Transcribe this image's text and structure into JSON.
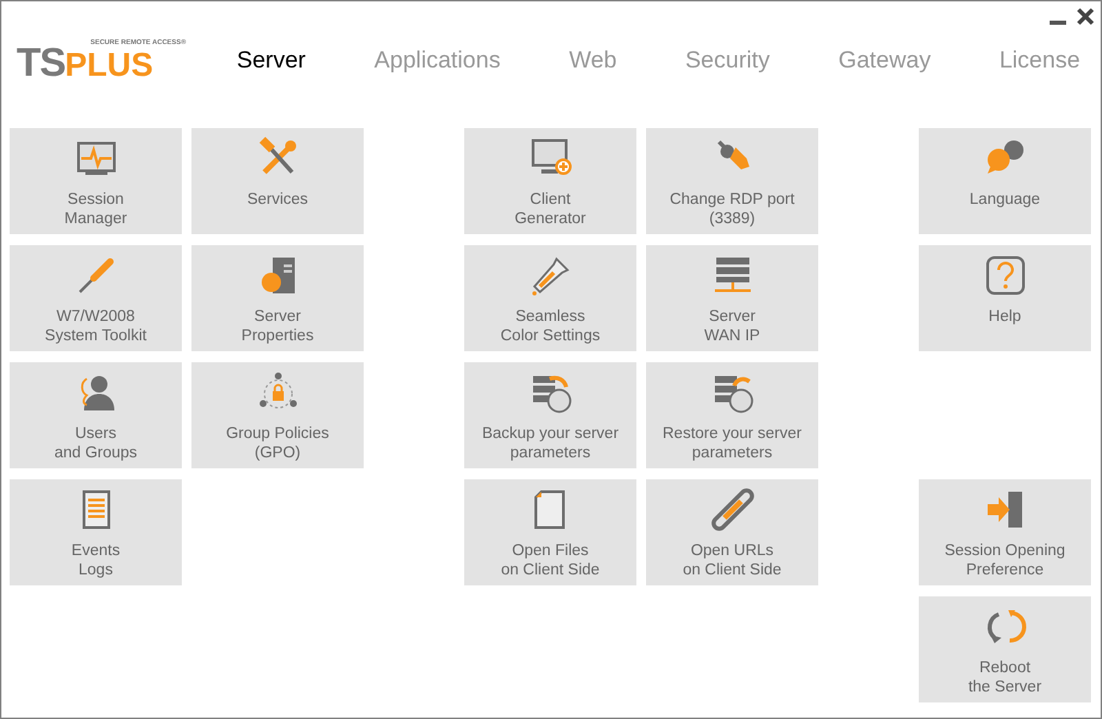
{
  "logo": {
    "main": "TS",
    "accent": "PLUS",
    "tagline": "SECURE REMOTE ACCESS®"
  },
  "tabs": [
    {
      "label": "Server",
      "selected": true
    },
    {
      "label": "Applications",
      "selected": false
    },
    {
      "label": "Web",
      "selected": false
    },
    {
      "label": "Security",
      "selected": false
    },
    {
      "label": "Gateway",
      "selected": false
    },
    {
      "label": "License",
      "selected": false
    }
  ],
  "groups": [
    {
      "columns": [
        [
          {
            "kind": "monitor-pulse",
            "lines": [
              "Session",
              "Manager"
            ]
          },
          {
            "kind": "screwdriver",
            "lines": [
              "W7/W2008",
              "System Toolkit"
            ]
          },
          {
            "kind": "user",
            "lines": [
              "Users",
              "and Groups"
            ]
          },
          {
            "kind": "scroll",
            "lines": [
              "Events",
              "Logs"
            ]
          }
        ],
        [
          {
            "kind": "tools",
            "lines": [
              "Services"
            ]
          },
          {
            "kind": "server-info",
            "lines": [
              "Server",
              "Properties"
            ]
          },
          {
            "kind": "group-lock",
            "lines": [
              "Group Policies",
              "(GPO)"
            ]
          }
        ]
      ]
    },
    {
      "columns": [
        [
          {
            "kind": "monitor-plus",
            "lines": [
              "Client",
              "Generator"
            ]
          },
          {
            "kind": "dropper",
            "lines": [
              "Seamless",
              "Color Settings"
            ]
          },
          {
            "kind": "backup",
            "lines": [
              "Backup your server",
              "parameters"
            ]
          },
          {
            "kind": "file",
            "lines": [
              "Open Files",
              "on Client Side"
            ]
          }
        ],
        [
          {
            "kind": "plug",
            "lines": [
              "Change RDP port",
              "(3389)"
            ]
          },
          {
            "kind": "server-network",
            "lines": [
              "Server",
              "WAN IP"
            ]
          },
          {
            "kind": "restore",
            "lines": [
              "Restore your server",
              "parameters"
            ]
          },
          {
            "kind": "link",
            "lines": [
              "Open URLs",
              "on Client Side"
            ]
          }
        ]
      ]
    }
  ],
  "side": {
    "top": [
      {
        "kind": "language",
        "lines": [
          "Language"
        ]
      },
      {
        "kind": "help",
        "lines": [
          "Help"
        ]
      }
    ],
    "bottom": [
      {
        "kind": "door-arrow",
        "lines": [
          "Session Opening",
          "Preference"
        ]
      },
      {
        "kind": "refresh",
        "lines": [
          "Reboot",
          "the Server"
        ]
      }
    ]
  }
}
